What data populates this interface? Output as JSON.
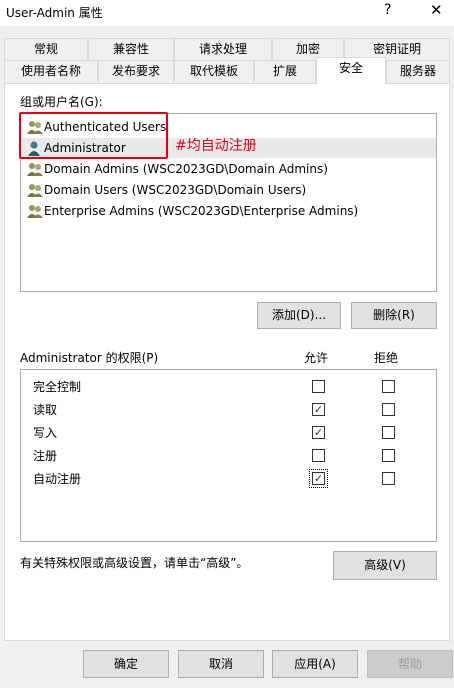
{
  "window": {
    "title": "User-Admin 属性",
    "help": "?",
    "close": "✕"
  },
  "tabs": {
    "row1": [
      "常规",
      "兼容性",
      "请求处理",
      "加密",
      "密钥证明"
    ],
    "row2": [
      "使用者名称",
      "发布要求",
      "取代模板",
      "扩展",
      "安全",
      "服务器"
    ],
    "active": "安全"
  },
  "groups_label": "组或用户名(G):",
  "users": [
    {
      "name": "Authenticated Users",
      "icon": "group-icon"
    },
    {
      "name": "Administrator",
      "icon": "user-icon",
      "selected": true
    },
    {
      "name": "Domain Admins (WSC2023GD\\Domain Admins)",
      "icon": "group-icon"
    },
    {
      "name": "Domain Users (WSC2023GD\\Domain Users)",
      "icon": "group-icon"
    },
    {
      "name": "Enterprise Admins (WSC2023GD\\Enterprise Admins)",
      "icon": "group-icon"
    }
  ],
  "annotation": "#均自动注册",
  "add_button": "添加(D)...",
  "remove_button": "删除(R)",
  "permissions_label": "Administrator 的权限(P)",
  "allow_header": "允许",
  "deny_header": "拒绝",
  "permissions": [
    {
      "name": "完全控制",
      "allow": false,
      "deny": false
    },
    {
      "name": "读取",
      "allow": true,
      "deny": false
    },
    {
      "name": "写入",
      "allow": true,
      "deny": false
    },
    {
      "name": "注册",
      "allow": false,
      "deny": false
    },
    {
      "name": "自动注册",
      "allow": true,
      "deny": false,
      "focused": true
    }
  ],
  "special_note": "有关特殊权限或高级设置，请单击“高级”。",
  "advanced_button": "高级(V)",
  "footer": {
    "ok": "确定",
    "cancel": "取消",
    "apply": "应用(A)",
    "help": "帮助"
  },
  "colors": {
    "annotation": "#e60012",
    "selection": "#e9e9e9",
    "panel": "#ffffff",
    "dialog": "#f0f0f0"
  }
}
